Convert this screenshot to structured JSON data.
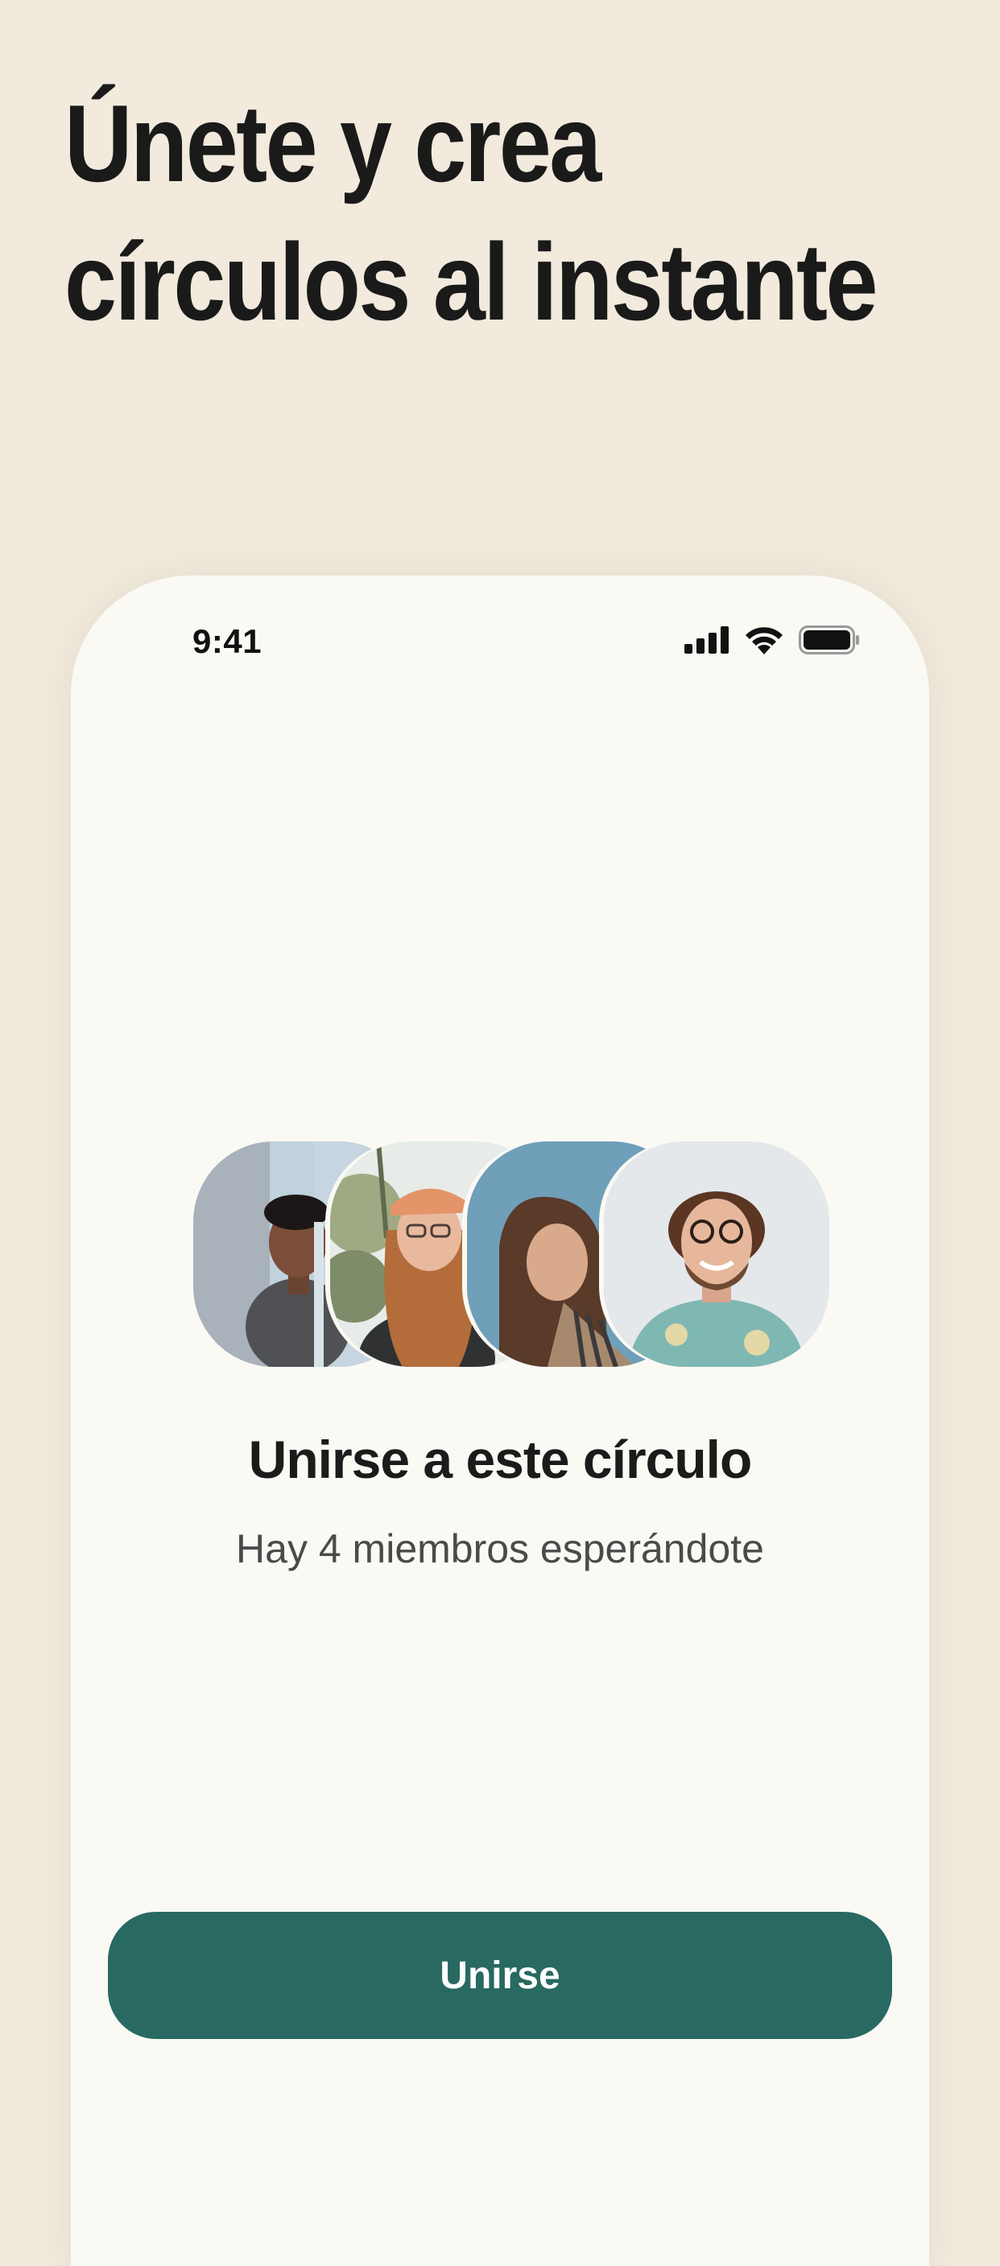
{
  "headline": {
    "line1": "Únete y crea",
    "line2": "círculos al instante"
  },
  "status_bar": {
    "time": "9:41",
    "icons": [
      "cellular-signal-icon",
      "wifi-icon",
      "battery-icon"
    ]
  },
  "circle": {
    "title": "Unirse a este círculo",
    "subtitle": "Hay 4 miembros esperándote",
    "members": [
      {
        "avatar": "member-avatar-1"
      },
      {
        "avatar": "member-avatar-2"
      },
      {
        "avatar": "member-avatar-3"
      },
      {
        "avatar": "member-avatar-4"
      }
    ]
  },
  "button": {
    "label": "Unirse"
  },
  "colors": {
    "background": "#F1EADD",
    "card": "#FAF9F4",
    "accent": "#286962",
    "text": "#1A1A1A"
  }
}
